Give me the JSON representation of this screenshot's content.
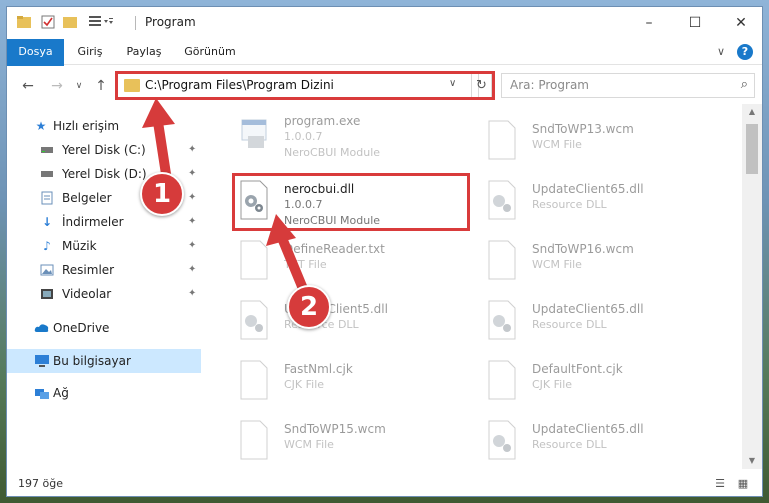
{
  "window": {
    "title": "Program"
  },
  "ribbon": {
    "tabs": [
      "Dosya",
      "Giriş",
      "Paylaş",
      "Görünüm"
    ],
    "help": "?"
  },
  "address": {
    "path": "C:\\Program Files\\Program Dizini"
  },
  "search": {
    "placeholder": "Ara: Program"
  },
  "sidebar": {
    "items": [
      {
        "label": "Hızlı erişim",
        "icon": "star-icon"
      },
      {
        "label": "Yerel Disk (C:)",
        "icon": "drive-icon"
      },
      {
        "label": "Yerel Disk (D:)",
        "icon": "drive-icon"
      },
      {
        "label": "Belgeler",
        "icon": "documents-icon"
      },
      {
        "label": "İndirmeler",
        "icon": "download-icon"
      },
      {
        "label": "Müzik",
        "icon": "music-icon"
      },
      {
        "label": "Resimler",
        "icon": "pictures-icon"
      },
      {
        "label": "Videolar",
        "icon": "video-icon"
      },
      {
        "label": "OneDrive",
        "icon": "cloud-icon"
      },
      {
        "label": "Bu bilgisayar",
        "icon": "computer-icon"
      },
      {
        "label": "Ağ",
        "icon": "network-icon"
      }
    ]
  },
  "files": {
    "left": [
      {
        "name": "program.exe",
        "version": "1.0.0.7",
        "desc": "NeroCBUI Module"
      },
      {
        "name": "nerocbui.dll",
        "version": "1.0.0.7",
        "desc": "NeroCBUI Module"
      },
      {
        "name": "DefineReader.txt",
        "version": "",
        "desc": "TXT File"
      },
      {
        "name": "UpdateClient5.dll",
        "version": "",
        "desc": "Resource DLL"
      },
      {
        "name": "FastNml.cjk",
        "version": "",
        "desc": "CJK File"
      },
      {
        "name": "SndToWP15.wcm",
        "version": "",
        "desc": "WCM File"
      }
    ],
    "right": [
      {
        "name": "SndToWP13.wcm",
        "desc": "WCM File"
      },
      {
        "name": "UpdateClient65.dll",
        "desc": "Resource DLL"
      },
      {
        "name": "SndToWP16.wcm",
        "desc": "WCM File"
      },
      {
        "name": "UpdateClient65.dll",
        "desc": "Resource DLL"
      },
      {
        "name": "DefaultFont.cjk",
        "desc": "CJK File"
      },
      {
        "name": "UpdateClient65.dll",
        "desc": "Resource DLL"
      }
    ]
  },
  "status": {
    "count": "197 öğe"
  },
  "callouts": [
    "1",
    "2"
  ],
  "colors": {
    "accent": "#1979ca",
    "highlight": "#d93b3b",
    "selected_nav": "#cce8ff"
  }
}
